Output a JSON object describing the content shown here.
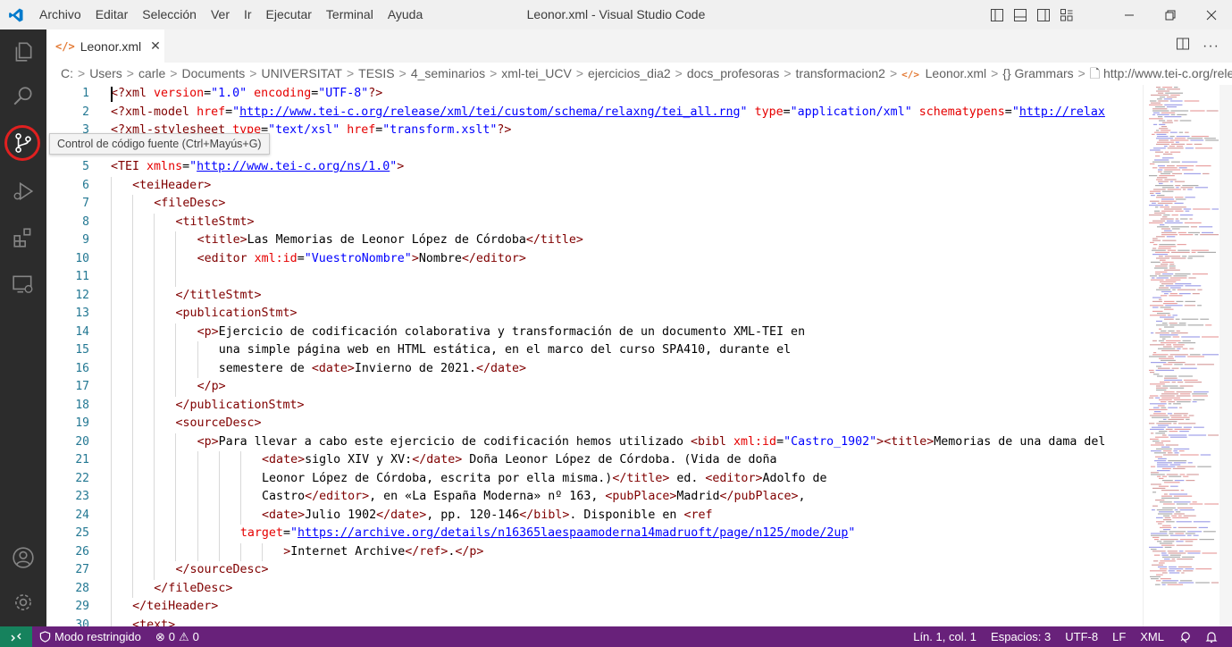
{
  "menu": [
    "Archivo",
    "Editar",
    "Selección",
    "Ver",
    "Ir",
    "Ejecutar",
    "Terminal",
    "Ayuda"
  ],
  "window_title": "Leonor.xml - Visual Studio Code",
  "tooltip": "Control de código fuente (Ctrl+Mayús+G)",
  "tab": {
    "label": "Leonor.xml"
  },
  "breadcrumb": [
    "C:",
    "Users",
    "carle",
    "Documents",
    "UNIVERSITAT",
    "TESIS",
    "4_seminarios",
    "xml-tei_UCV",
    "ejercicios_dia2",
    "docs_profesoras",
    "transformacion2",
    "Leonor.xml",
    "{} Grammars",
    "http://www.tei-c.org/release/x"
  ],
  "line_numbers": [
    "1",
    "2",
    "3",
    "",
    "5",
    "6",
    "7",
    "8",
    "9",
    "10",
    "11",
    "12",
    "13",
    "14",
    "15",
    "16",
    "17",
    "18",
    "19",
    "20",
    "21",
    "22",
    "23",
    "24",
    "25",
    "26",
    "27",
    "28",
    "29",
    "30"
  ],
  "code": [
    [
      "<?xml version=\"1.0\" encoding=\"UTF-8\"?>"
    ],
    [
      "<?xml-model href=\"http://www.tei-c.org/release/xml/tei/custom/schema/relaxng/tei_all.rng\" type=\"application/xml\" schematypens=\"http://relax"
    ],
    [
      "<?xml-stylesheet type=\"text/xsl\" href=\"transform.xslt\"?>"
    ],
    [
      ""
    ],
    [
      "<TEI xmlns=\"http://www.tei-c.org/ns/1.0\">"
    ],
    [
      "<teiHeader>"
    ],
    [
      "<fileDesc>"
    ],
    [
      "<titleStmt>"
    ],
    [
      "<title>Las Memorias de Leonor López de Córdoba</title>"
    ],
    [
      "<editor xml:id=\"VuestroNombre\">Nombre</editor>"
    ],
    [
      ""
    ],
    [
      "</titleStmt>"
    ],
    [
      "<publicationStmt>"
    ],
    [
      "<p>Ejercicio de codificación colaborativa y transformación de un documento XML-TEI en"
    ],
    [
      "una simple página web en HTML estática, en el marco del curso SPA410, durante el"
    ],
    [
      "semestere de <date>Invierno de 2021.</date>"
    ],
    [
      "</p>"
    ],
    [
      "</publicationStmt>"
    ],
    [
      "<sourceDesc>"
    ],
    [
      "<p>Para llevar a cabo este ejercicio de codificación hemos utilizado <bibl xml:id=\"Castro_1902\"><title>Memorias de una dama del"
    ],
    [
      "<date>siglo XIV y XV:</date> Doña Leonor López de Córdoba. (Vida de doña"
    ],
    [
      "Leonor López de Córdoba, escrita por ella misma.)</title> ed. <editor>Adolfo de"
    ],
    [
      "Castro</editor>, en «La España Moderna» nº 163, <pubPlace>Madrid</pubPlace>,"
    ],
    [
      "<date>Julio 1902</date>, pp. 120-146</bibl>. Disponible en <ref"
    ],
    [
      "target=\"https://archive.org/details/n16365laespaamoderna14madruoft/page/n125/mode/2up\""
    ],
    [
      ">Internet Archive</ref>.</p>"
    ],
    [
      "</sourceDesc>"
    ],
    [
      "</fileDesc>"
    ],
    [
      "</teiHeader>"
    ],
    [
      "<text>"
    ]
  ],
  "status": {
    "restricted": "Modo restringido",
    "errors": "0",
    "warnings": "0",
    "position": "Lín. 1, col. 1",
    "spaces": "Espacios: 3",
    "encoding": "UTF-8",
    "eol": "LF",
    "language": "XML"
  },
  "colors": {
    "tag": "#800000",
    "attribute": "#e50000",
    "string": "#0000ff",
    "statusbar": "#68217a",
    "remote": "#16825d"
  }
}
